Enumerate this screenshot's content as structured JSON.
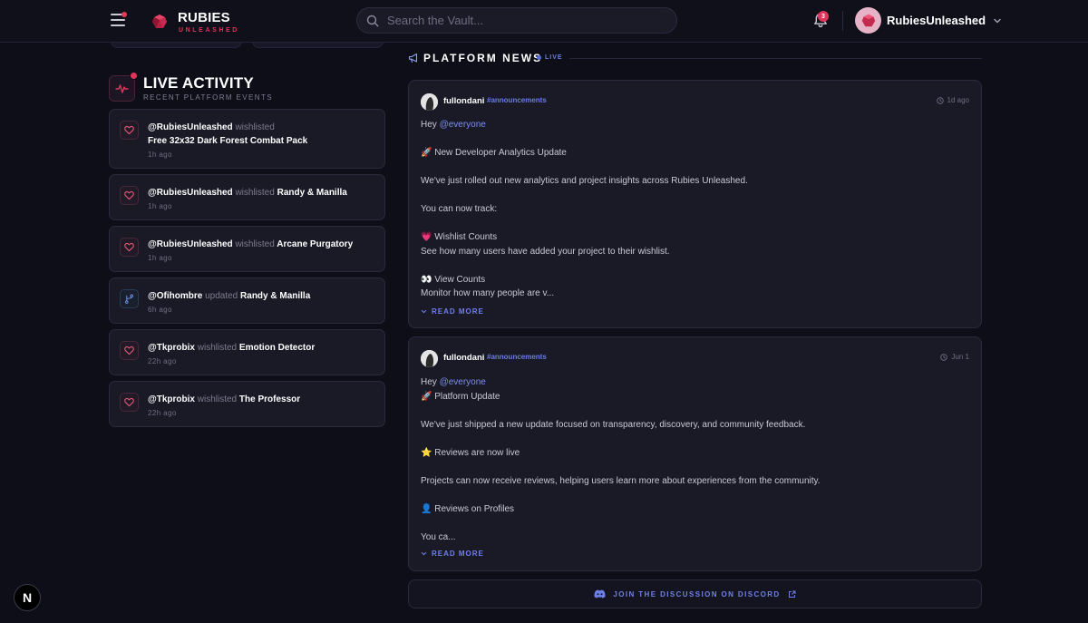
{
  "header": {
    "brand_title": "RUBIES",
    "brand_sub": "UNLEASHED",
    "search_placeholder": "Search the Vault...",
    "notification_count": "3",
    "username": "RubiesUnleashed"
  },
  "live_activity": {
    "title": "LIVE ACTIVITY",
    "subtitle": "RECENT PLATFORM EVENTS",
    "items": [
      {
        "user": "@RubiesUnleashed",
        "verb": "wishlisted",
        "target": "Free 32x32 Dark Forest Combat Pack",
        "time": "1h  ago",
        "icon": "heart-icon"
      },
      {
        "user": "@RubiesUnleashed",
        "verb": "wishlisted",
        "target": "Randy & Manilla",
        "time": "1h  ago",
        "icon": "heart-icon"
      },
      {
        "user": "@RubiesUnleashed",
        "verb": "wishlisted",
        "target": "Arcane Purgatory",
        "time": "1h  ago",
        "icon": "heart-icon"
      },
      {
        "user": "@Ofihombre",
        "verb": "updated",
        "target": "Randy & Manilla",
        "time": "6h  ago",
        "icon": "git-branch-icon"
      },
      {
        "user": "@Tkprobix",
        "verb": "wishlisted",
        "target": "Emotion Detector",
        "time": "22h  ago",
        "icon": "heart-icon"
      },
      {
        "user": "@Tkprobix",
        "verb": "wishlisted",
        "target": "The Professor",
        "time": "22h  ago",
        "icon": "heart-icon"
      }
    ]
  },
  "platform_news": {
    "title": "PLATFORM NEWS",
    "live_label": "LIVE",
    "posts": [
      {
        "author": "fullondani",
        "channel": "#announcements",
        "date": "1d ago",
        "greeting": "Hey ",
        "mention": "@everyone",
        "lines": [
          "",
          "🚀 New Developer Analytics Update",
          "",
          "We've just rolled out new analytics and project insights across Rubies Unleashed.",
          "",
          "You can now track:",
          "",
          "💗 Wishlist Counts",
          "See how many users have added your project to their wishlist.",
          "",
          "👀 View Counts",
          "Monitor how many people are v..."
        ],
        "read_more": "READ MORE"
      },
      {
        "author": "fullondani",
        "channel": "#announcements",
        "date": "Jun 1",
        "greeting": "Hey ",
        "mention": "@everyone",
        "lines": [
          "🚀 Platform Update",
          "",
          "We've just shipped a new update focused on transparency, discovery, and community feedback.",
          "",
          "⭐ Reviews are now live",
          "",
          "Projects can now receive reviews, helping users learn more about experiences from the community.",
          "",
          "👤 Reviews on Profiles",
          "",
          "You ca..."
        ],
        "read_more": "READ MORE"
      }
    ],
    "discord_label": "JOIN THE DISCUSSION ON DISCORD"
  },
  "dev_badge": "N",
  "colors": {
    "accent_red": "#e0345a",
    "accent_blue": "#6e80e6",
    "background": "#0e0e18",
    "card": "#1a1a27"
  }
}
